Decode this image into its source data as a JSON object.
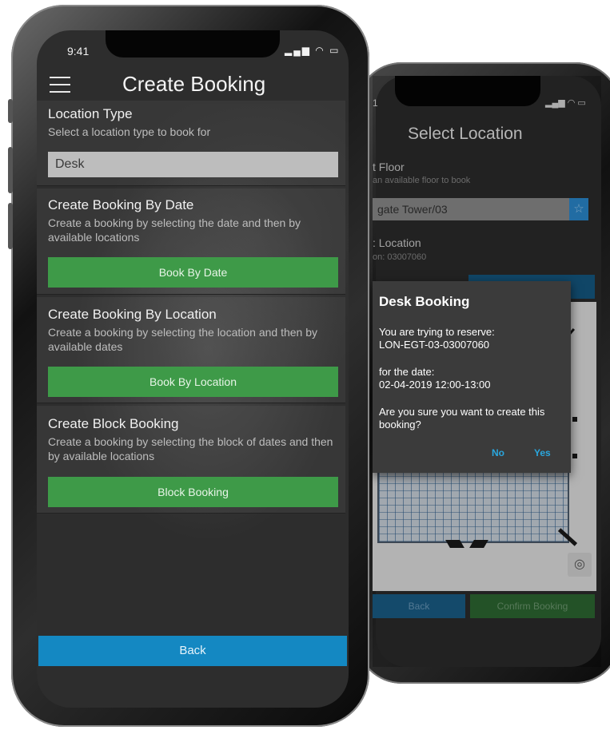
{
  "back_screen": {
    "status_time": "1",
    "title": "Select Location",
    "floor_section": {
      "title": "t Floor",
      "subtitle": "an available floor to book",
      "value": "gate Tower/03"
    },
    "location_section": {
      "title": ": Location",
      "subtitle": "on: 03007060"
    },
    "dialog": {
      "title": "Desk Booking",
      "line1": "You are trying to reserve:",
      "line2": "LON-EGT-03-03007060",
      "line3": "for the date:",
      "line4": "02-04-2019 12:00-13:00",
      "line5": "Are you sure you want to create this booking?",
      "no_label": "No",
      "yes_label": "Yes"
    },
    "back_label": "Back",
    "confirm_label": "Confirm Booking"
  },
  "front_screen": {
    "status_time": "9:41",
    "title": "Create Booking",
    "location_type": {
      "title": "Location Type",
      "subtitle": "Select a location type to book for",
      "selected": "Desk"
    },
    "by_date": {
      "title": "Create Booking By Date",
      "subtitle": "Create a booking by selecting the date and then by available locations",
      "button": "Book By Date"
    },
    "by_location": {
      "title": "Create Booking By Location",
      "subtitle": "Create a booking by selecting the location and then by available dates",
      "button": "Book By Location"
    },
    "block": {
      "title": "Create Block Booking",
      "subtitle": "Create a booking by selecting the block of dates and then by available locations",
      "button": "Block Booking"
    },
    "back_label": "Back"
  },
  "colors": {
    "green_button": "#3e9a48",
    "blue_button": "#1488c2",
    "dialog_action": "#2aa6dd"
  }
}
